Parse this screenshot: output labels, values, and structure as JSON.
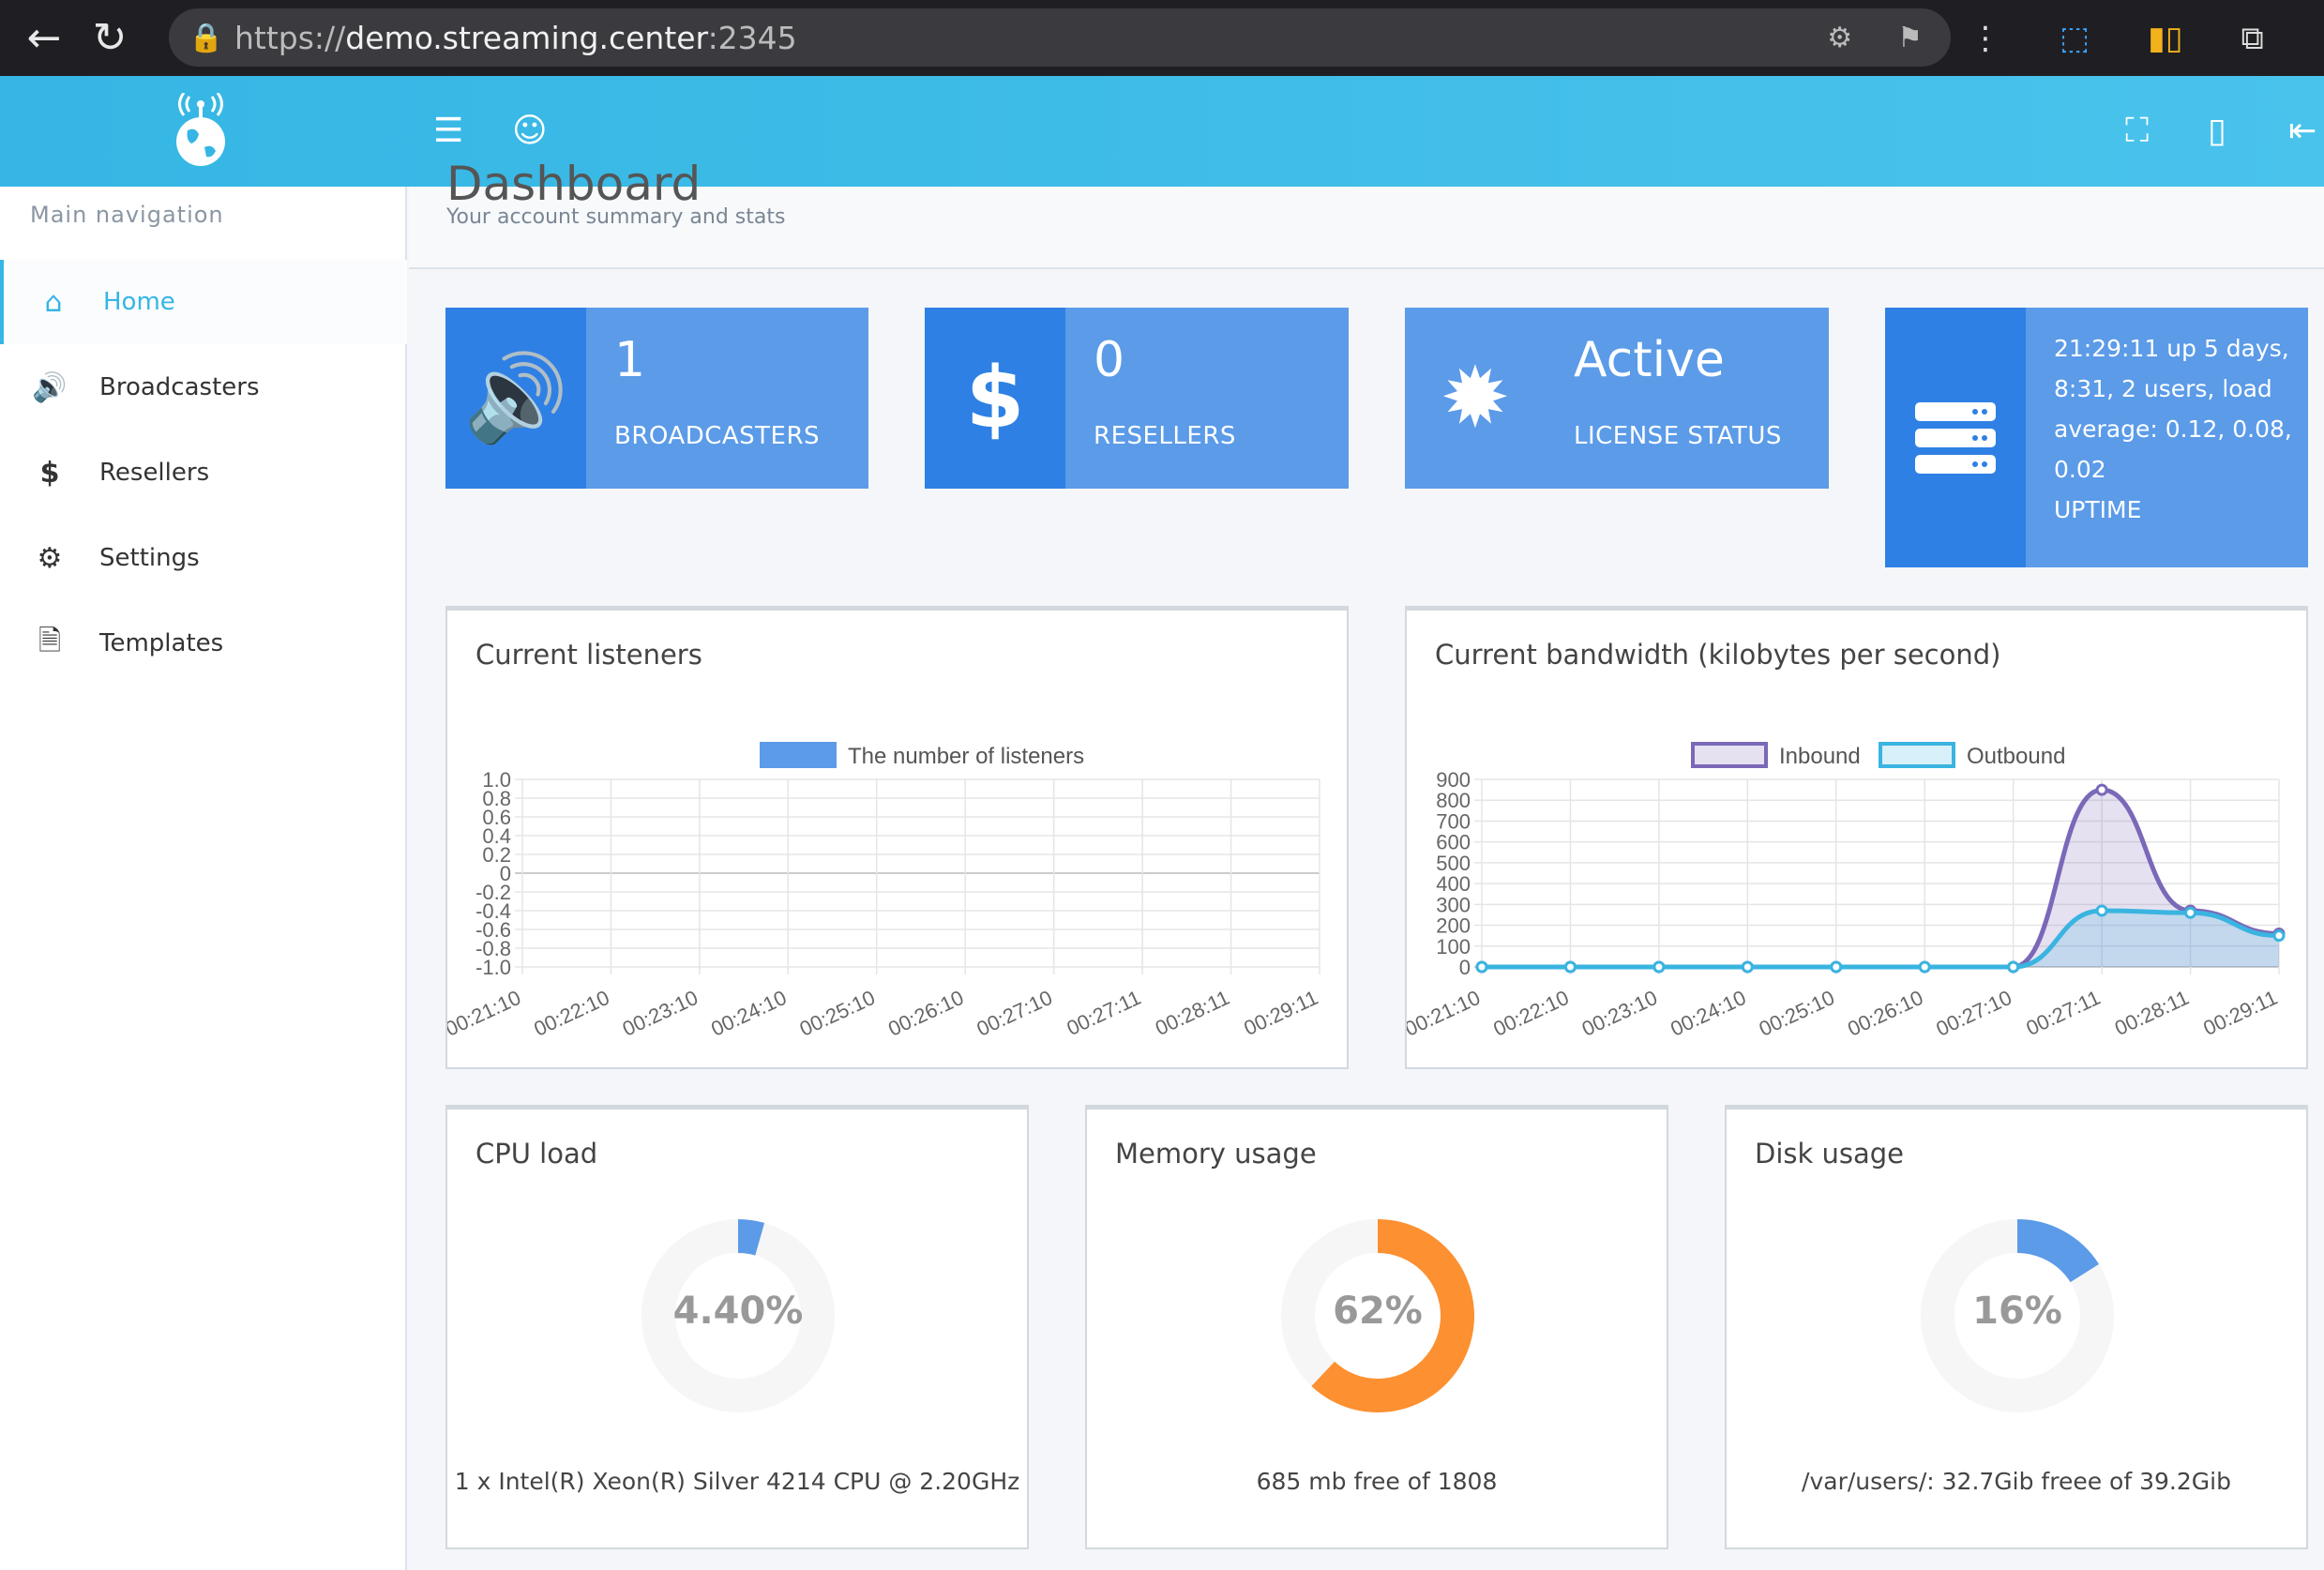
{
  "browser": {
    "url_scheme": "https://",
    "url_host": "demo.streaming.center",
    "url_port": ":2345"
  },
  "sidebar": {
    "title": "Main navigation",
    "items": [
      {
        "label": "Home",
        "icon": "home-icon",
        "active": true
      },
      {
        "label": "Broadcasters",
        "icon": "volume-icon",
        "active": false
      },
      {
        "label": "Resellers",
        "icon": "dollar-icon",
        "active": false
      },
      {
        "label": "Settings",
        "icon": "gears-icon",
        "active": false
      },
      {
        "label": "Templates",
        "icon": "file-icon",
        "active": false
      }
    ]
  },
  "page": {
    "title": "Dashboard",
    "subtitle": "Your account summary and stats"
  },
  "stats": {
    "broadcasters": {
      "value": "1",
      "label": "BROADCASTERS"
    },
    "resellers": {
      "value": "0",
      "label": "RESELLERS"
    },
    "license": {
      "value": "Active",
      "label": "LICENSE STATUS"
    },
    "uptime": {
      "lines": [
        "21:29:11 up 5 days,",
        "8:31, 2 users, load",
        "average: 0.12, 0.08,",
        "0.02"
      ],
      "label": "UPTIME"
    }
  },
  "colors": {
    "header": "#35b6e4",
    "stat_bg": "#5b9be8",
    "stat_icon_bg": "#2f80e4",
    "inbound": "#7b68b8",
    "outbound": "#3ab4e0",
    "cpu": "#5b9be8",
    "memory": "#fd9030",
    "disk": "#5b9be8"
  },
  "listeners": {
    "title": "Current listeners",
    "chart_data": {
      "type": "line",
      "categories": [
        "00:21:10",
        "00:22:10",
        "00:23:10",
        "00:24:10",
        "00:25:10",
        "00:26:10",
        "00:27:10",
        "00:27:11",
        "00:28:11",
        "00:29:11"
      ],
      "series": [
        {
          "name": "The number of listeners",
          "values": []
        }
      ],
      "y_ticks": [
        "1.0",
        "0.8",
        "0.6",
        "0.4",
        "0.2",
        "0",
        "-0.2",
        "-0.4",
        "-0.6",
        "-0.8",
        "-1.0"
      ],
      "ylim": [
        -1.0,
        1.0
      ],
      "legend": "top"
    }
  },
  "bandwidth": {
    "title": "Current bandwidth (kilobytes per second)",
    "chart_data": {
      "type": "area",
      "categories": [
        "00:21:10",
        "00:22:10",
        "00:23:10",
        "00:24:10",
        "00:25:10",
        "00:26:10",
        "00:27:10",
        "00:27:11",
        "00:28:11",
        "00:29:11"
      ],
      "series": [
        {
          "name": "Inbound",
          "values": [
            0,
            0,
            0,
            0,
            0,
            0,
            0,
            850,
            270,
            160
          ]
        },
        {
          "name": "Outbound",
          "values": [
            0,
            0,
            0,
            0,
            0,
            0,
            0,
            270,
            260,
            150
          ]
        }
      ],
      "y_ticks": [
        "900",
        "800",
        "700",
        "600",
        "500",
        "400",
        "300",
        "200",
        "100",
        "0"
      ],
      "ylim": [
        0,
        900
      ],
      "legend": "top"
    }
  },
  "cpu": {
    "title": "CPU load",
    "value_text": "4.40%",
    "value": 4.4,
    "footer": "1 x Intel(R) Xeon(R) Silver 4214 CPU @ 2.20GHz"
  },
  "memory": {
    "title": "Memory usage",
    "value_text": "62%",
    "value": 62,
    "footer": "685 mb free of 1808"
  },
  "disk": {
    "title": "Disk usage",
    "value_text": "16%",
    "value": 16,
    "footer": "/var/users/: 32.7Gib freee of 39.2Gib"
  }
}
